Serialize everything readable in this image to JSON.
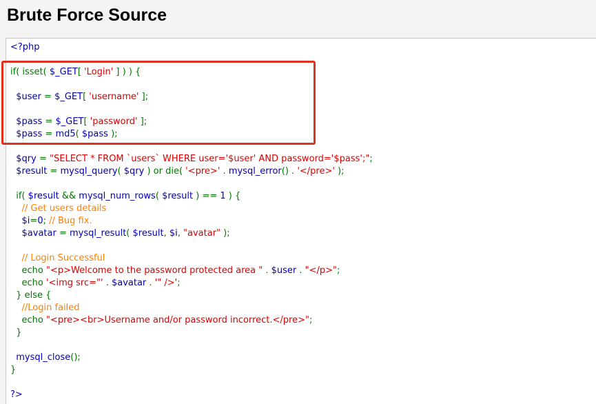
{
  "header": {
    "title": "Brute Force Source"
  },
  "colors": {
    "keyword": "#007700",
    "variable": "#0000bb",
    "string": "#dd0000",
    "comment": "#ff8000",
    "highlight_box": "#e03121"
  },
  "code": {
    "lines": [
      [
        {
          "t": "def",
          "s": "<?php"
        }
      ],
      [],
      [
        {
          "t": "kw",
          "s": "if( isset( "
        },
        {
          "t": "var",
          "s": "$_GET"
        },
        {
          "t": "kw",
          "s": "[ "
        },
        {
          "t": "str",
          "s": "'Login'"
        },
        {
          "t": "kw",
          "s": " ] ) ) {"
        }
      ],
      [],
      [
        {
          "t": "kw",
          "s": "  "
        },
        {
          "t": "var",
          "s": "$user"
        },
        {
          "t": "kw",
          "s": " = "
        },
        {
          "t": "var",
          "s": "$_GET"
        },
        {
          "t": "kw",
          "s": "[ "
        },
        {
          "t": "str",
          "s": "'username'"
        },
        {
          "t": "kw",
          "s": " ];"
        }
      ],
      [],
      [
        {
          "t": "kw",
          "s": "  "
        },
        {
          "t": "var",
          "s": "$pass"
        },
        {
          "t": "kw",
          "s": " = "
        },
        {
          "t": "var",
          "s": "$_GET"
        },
        {
          "t": "kw",
          "s": "[ "
        },
        {
          "t": "str",
          "s": "'password'"
        },
        {
          "t": "kw",
          "s": " ];"
        }
      ],
      [
        {
          "t": "kw",
          "s": "  "
        },
        {
          "t": "var",
          "s": "$pass"
        },
        {
          "t": "kw",
          "s": " = "
        },
        {
          "t": "var",
          "s": "md5"
        },
        {
          "t": "kw",
          "s": "( "
        },
        {
          "t": "var",
          "s": "$pass"
        },
        {
          "t": "kw",
          "s": " );"
        }
      ],
      [],
      [
        {
          "t": "kw",
          "s": "  "
        },
        {
          "t": "var",
          "s": "$qry"
        },
        {
          "t": "kw",
          "s": " = "
        },
        {
          "t": "str",
          "s": "\"SELECT * FROM `users` WHERE user='$user' AND password='$pass';\""
        },
        {
          "t": "kw",
          "s": ";"
        }
      ],
      [
        {
          "t": "kw",
          "s": "  "
        },
        {
          "t": "var",
          "s": "$result"
        },
        {
          "t": "kw",
          "s": " = "
        },
        {
          "t": "var",
          "s": "mysql_query"
        },
        {
          "t": "kw",
          "s": "( "
        },
        {
          "t": "var",
          "s": "$qry"
        },
        {
          "t": "kw",
          "s": " ) or die( "
        },
        {
          "t": "str",
          "s": "'<pre>'"
        },
        {
          "t": "kw",
          "s": " . "
        },
        {
          "t": "var",
          "s": "mysql_error"
        },
        {
          "t": "kw",
          "s": "() . "
        },
        {
          "t": "str",
          "s": "'</pre>'"
        },
        {
          "t": "kw",
          "s": " );"
        }
      ],
      [],
      [
        {
          "t": "kw",
          "s": "  if( "
        },
        {
          "t": "var",
          "s": "$result"
        },
        {
          "t": "kw",
          "s": " && "
        },
        {
          "t": "var",
          "s": "mysql_num_rows"
        },
        {
          "t": "kw",
          "s": "( "
        },
        {
          "t": "var",
          "s": "$result"
        },
        {
          "t": "kw",
          "s": " ) == "
        },
        {
          "t": "var",
          "s": "1"
        },
        {
          "t": "kw",
          "s": " ) {"
        }
      ],
      [
        {
          "t": "kw",
          "s": "    "
        },
        {
          "t": "com",
          "s": "// Get users details"
        }
      ],
      [
        {
          "t": "kw",
          "s": "    "
        },
        {
          "t": "var",
          "s": "$i"
        },
        {
          "t": "kw",
          "s": "="
        },
        {
          "t": "var",
          "s": "0"
        },
        {
          "t": "kw",
          "s": "; "
        },
        {
          "t": "com",
          "s": "// Bug fix."
        }
      ],
      [
        {
          "t": "kw",
          "s": "    "
        },
        {
          "t": "var",
          "s": "$avatar"
        },
        {
          "t": "kw",
          "s": " = "
        },
        {
          "t": "var",
          "s": "mysql_result"
        },
        {
          "t": "kw",
          "s": "( "
        },
        {
          "t": "var",
          "s": "$result"
        },
        {
          "t": "kw",
          "s": ", "
        },
        {
          "t": "var",
          "s": "$i"
        },
        {
          "t": "kw",
          "s": ", "
        },
        {
          "t": "str",
          "s": "\"avatar\""
        },
        {
          "t": "kw",
          "s": " );"
        }
      ],
      [],
      [
        {
          "t": "kw",
          "s": "    "
        },
        {
          "t": "com",
          "s": "// Login Successful"
        }
      ],
      [
        {
          "t": "kw",
          "s": "    echo "
        },
        {
          "t": "str",
          "s": "\"<p>Welcome to the password protected area \""
        },
        {
          "t": "kw",
          "s": " . "
        },
        {
          "t": "var",
          "s": "$user"
        },
        {
          "t": "kw",
          "s": " . "
        },
        {
          "t": "str",
          "s": "\"</p>\""
        },
        {
          "t": "kw",
          "s": ";"
        }
      ],
      [
        {
          "t": "kw",
          "s": "    echo "
        },
        {
          "t": "str",
          "s": "'<img src=\"'"
        },
        {
          "t": "kw",
          "s": " . "
        },
        {
          "t": "var",
          "s": "$avatar"
        },
        {
          "t": "kw",
          "s": " . "
        },
        {
          "t": "str",
          "s": "'\" />'"
        },
        {
          "t": "kw",
          "s": ";"
        }
      ],
      [
        {
          "t": "kw",
          "s": "  } else {"
        }
      ],
      [
        {
          "t": "kw",
          "s": "    "
        },
        {
          "t": "com",
          "s": "//Login failed"
        }
      ],
      [
        {
          "t": "kw",
          "s": "    echo "
        },
        {
          "t": "str",
          "s": "\"<pre><br>Username and/or password incorrect.</pre>\""
        },
        {
          "t": "kw",
          "s": ";"
        }
      ],
      [
        {
          "t": "kw",
          "s": "  }"
        }
      ],
      [],
      [
        {
          "t": "kw",
          "s": "  "
        },
        {
          "t": "var",
          "s": "mysql_close"
        },
        {
          "t": "kw",
          "s": "();"
        }
      ],
      [
        {
          "t": "kw",
          "s": "}"
        }
      ],
      [],
      [
        {
          "t": "def",
          "s": "?>"
        }
      ]
    ]
  }
}
